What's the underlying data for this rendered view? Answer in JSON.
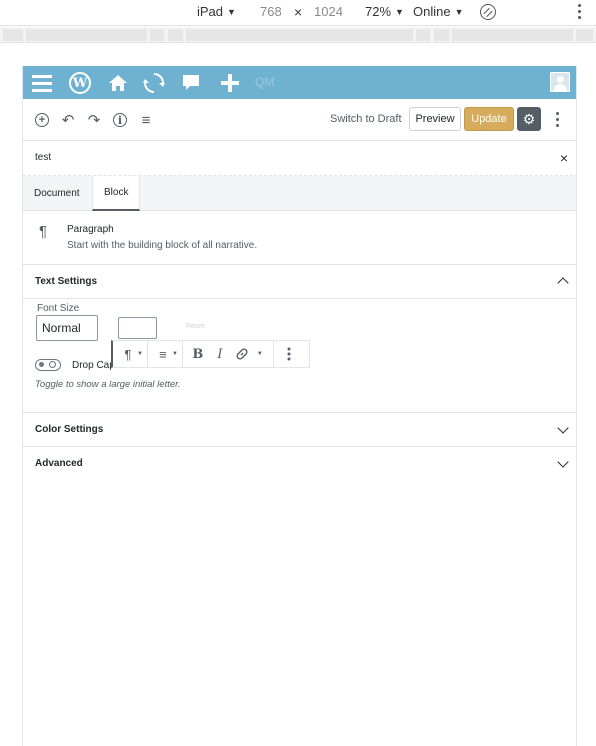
{
  "devtools": {
    "device": "iPad",
    "width": "768",
    "times": "×",
    "height": "1024",
    "zoom": "72%",
    "network": "Online",
    "caret": "▼"
  },
  "adminbar": {
    "menu_icon": "hamburger-icon",
    "wp_logo": "W",
    "qm": "QM"
  },
  "toolbar": {
    "add_icon": "+",
    "undo_icon": "↶",
    "redo_icon": "↷",
    "info_icon": "i",
    "outline_icon": "≡",
    "switch_draft": "Switch to Draft",
    "preview": "Preview",
    "update": "Update",
    "settings_icon": "⚙"
  },
  "sidebar": {
    "title": "test",
    "close": "×",
    "tabs": [
      {
        "label": "Document"
      },
      {
        "label": "Block"
      }
    ],
    "block": {
      "icon": "¶",
      "name": "Paragraph",
      "description": "Start with the building block of all narrative."
    },
    "text_settings": {
      "title": "Text Settings",
      "font_size_label": "Font Size",
      "font_size_value": "Normal",
      "reset": "Reset",
      "drop_cap_label": "Drop Cap",
      "help": "Toggle to show a large initial letter."
    },
    "color_settings": {
      "title": "Color Settings"
    },
    "advanced": {
      "title": "Advanced"
    }
  },
  "block_toolbar": {
    "paragraph": "¶",
    "align": "≡",
    "bold": "B",
    "italic": "I",
    "link": "🔗",
    "caret": "▼"
  }
}
